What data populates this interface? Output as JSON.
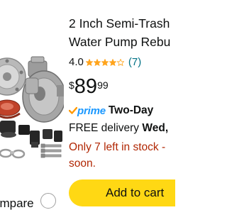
{
  "product": {
    "title_line1": "2 Inch Semi-Trash",
    "title_line2": "Water Pump Rebu",
    "rating_value": "4.0",
    "stars_filled": 4,
    "stars_total": 5,
    "review_count": "(7)",
    "price_symbol": "$",
    "price_whole": "89",
    "price_fraction": "99",
    "prime_label": "prime",
    "shipping_label": "Two-Day",
    "delivery_prefix": "FREE delivery ",
    "delivery_day": "Wed,",
    "stock_line1": "Only 7 left in stock -",
    "stock_line2": "soon."
  },
  "actions": {
    "compare_label": "ompare",
    "add_to_cart_label": "Add to cart"
  },
  "colors": {
    "add_to_cart_bg": "#ffd814",
    "star": "#ffa41c",
    "prime_blue": "#1a98ff",
    "link_teal": "#007185",
    "stock_red": "#b12704",
    "check_orange": "#ff9900"
  },
  "icons": {
    "rating": "star-icon",
    "prime": "prime-check-icon",
    "compare": "compare-radio-icon"
  }
}
